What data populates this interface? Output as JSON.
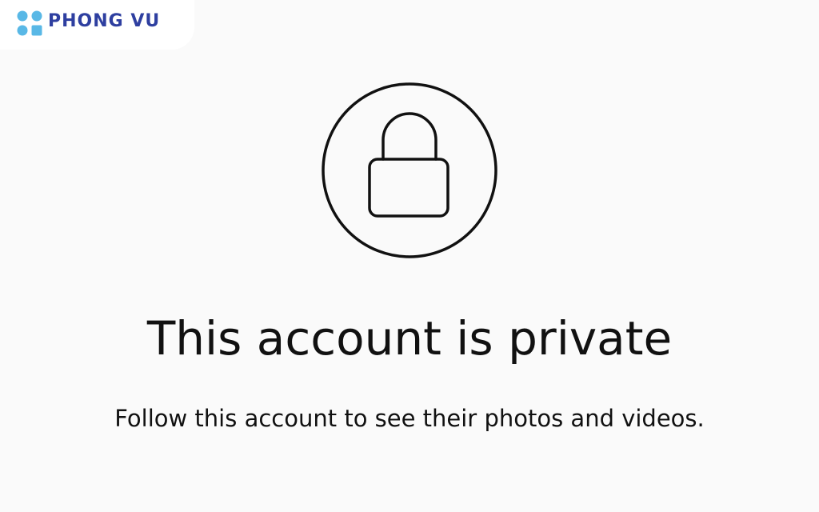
{
  "watermark": {
    "brand_text": "PHONG VU",
    "brand_color": "#2e3fa0",
    "mark_color": "#59b8e6",
    "mark_icon": "phong-vu-logo-icon"
  },
  "private_notice": {
    "lock_icon": "lock-icon",
    "title": "This account is private",
    "subtitle": "Follow this account to see their photos and videos."
  }
}
